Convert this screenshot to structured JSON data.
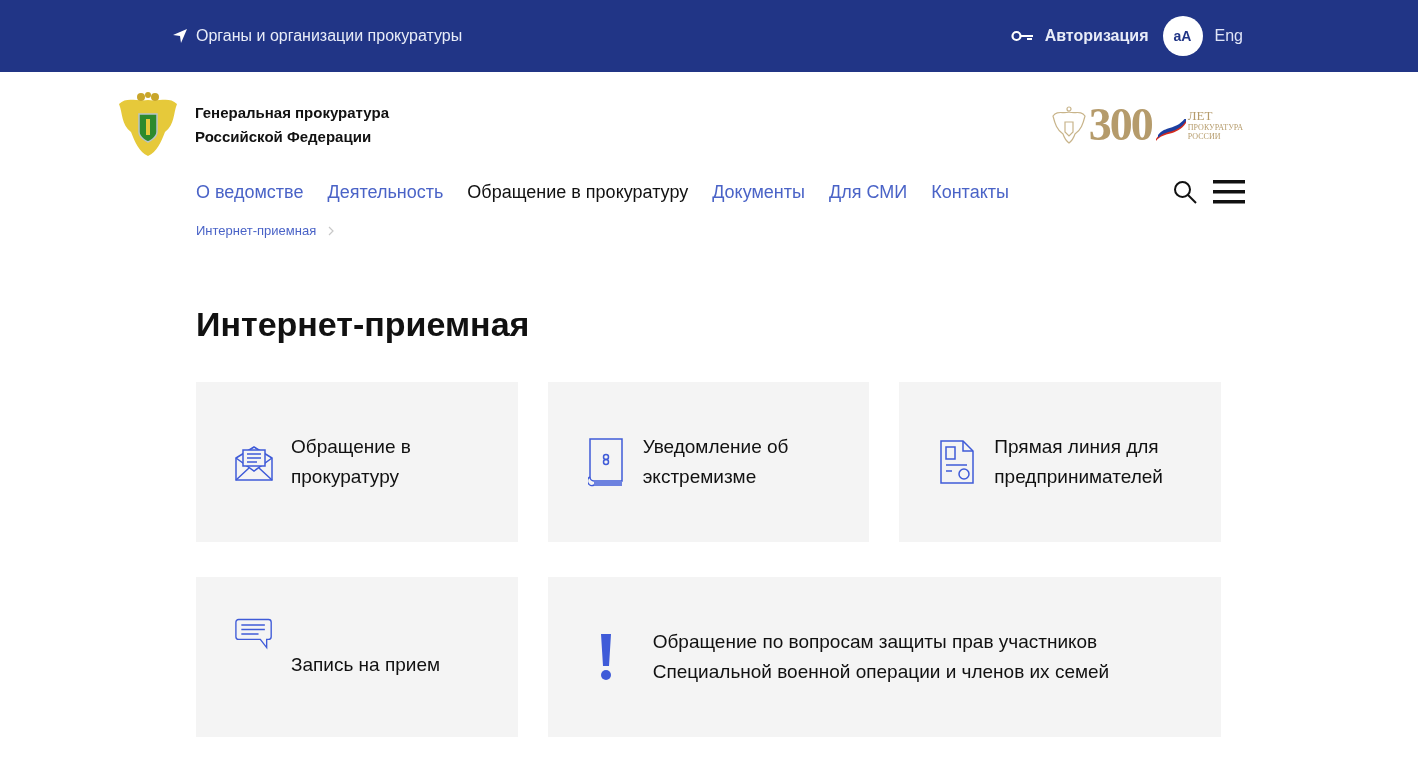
{
  "top_bar": {
    "organs_link": "Органы и организации прокуратуры",
    "login": "Авторизация",
    "font_size_button": "аА",
    "language": "Eng"
  },
  "header": {
    "title_lines": [
      "Генеральная прокуратура",
      "Российской Федерации"
    ],
    "anniversary_logo": {
      "number": "300",
      "word": "ЛЕТ",
      "line_1": "ПРОКУРАТУРА",
      "line_2": "РОССИИ"
    }
  },
  "nav": [
    {
      "label": "О ведомстве",
      "selected": false
    },
    {
      "label": "Деятельность",
      "selected": false
    },
    {
      "label": "Обращение в прокуратуру",
      "selected": true
    },
    {
      "label": "Документы",
      "selected": false
    },
    {
      "label": "Для СМИ",
      "selected": false
    },
    {
      "label": "Контакты",
      "selected": false
    }
  ],
  "breadcrumbs": [
    "Интернет-приемная"
  ],
  "page_title": "Интернет-приемная",
  "cards": [
    {
      "kind": "envelope",
      "lines": [
        "Обращение в",
        "прокуратуру"
      ]
    },
    {
      "kind": "book",
      "lines": [
        "Уведомление об",
        "экстремизме"
      ]
    },
    {
      "kind": "document",
      "lines": [
        "Прямая линия для",
        "предпринимателей"
      ]
    },
    {
      "kind": "chat",
      "lines": [
        "Запись на прием"
      ]
    },
    {
      "kind": "alert",
      "lines": [
        "Обращение по вопросам защиты прав участников",
        "Специальной военной операции и членов их семей"
      ]
    }
  ]
}
